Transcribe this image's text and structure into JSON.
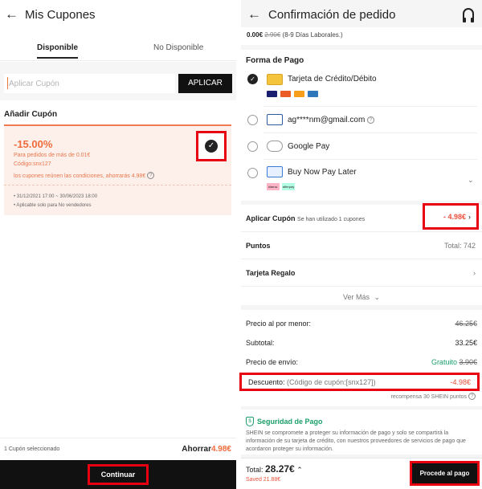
{
  "left": {
    "title": "Mis Cupones",
    "tabs": [
      "Disponible",
      "No Disponible"
    ],
    "input_placeholder": "Aplicar Cupón",
    "apply_label": "APLICAR",
    "section_label": "Añadir Cupón",
    "coupon": {
      "percent": "-15.00%",
      "min_order": "Para pedidos de más de 0.01€",
      "code": "Código:snx127",
      "savings_note": "los cupones reúnen las condiciones, ahorrarás 4.98€",
      "validity": "• 31/12/2021  17:00 ~ 30/06/2023  18:00",
      "scope": "• Aplicable solo para No vendedores",
      "check": "✓"
    },
    "footer": {
      "selected": "1 Cupón seleccionado",
      "ahorrar_label": "Ahorrar",
      "ahorrar_amount": "4.98€",
      "continue_label": "Continuar"
    }
  },
  "right": {
    "title": "Confirmación de pedido",
    "shipping": {
      "price": "0.00€",
      "old_price": "2.90€",
      "days": "(8-9 Días Laborales.)"
    },
    "payment": {
      "title": "Forma de Pago",
      "methods": [
        {
          "label": "Tarjeta de Crédito/Débito",
          "selected": true,
          "icon": "credit-card-icon"
        },
        {
          "label": "ag****nm@gmail.com",
          "selected": false,
          "icon": "paypal-icon"
        },
        {
          "label": "Google Pay",
          "selected": false,
          "icon": "google-pay-icon"
        },
        {
          "label": "Buy Now Pay Later",
          "selected": false,
          "icon": "calendar-icon"
        }
      ],
      "bnpl_logos": [
        "klarna.",
        "afterpay"
      ]
    },
    "options": {
      "coupon_label": "Aplicar Cupón",
      "coupon_sub": "Se han utilizado 1 cupones",
      "coupon_value": "- 4.98€",
      "points_label": "Puntos",
      "points_value": "Total: 742",
      "gift_label": "Tarjeta Regalo",
      "ver_mas": "Ver Más"
    },
    "summary": {
      "retail_label": "Precio al por menor:",
      "retail_value": "46.25€",
      "subtotal_label": "Subtotal:",
      "subtotal_value": "33.25€",
      "shipping_label": "Precio de envío:",
      "shipping_free": "Gratuito",
      "shipping_old": "3.90€",
      "discount_label": "Descuento:",
      "discount_code": "(Código de cupón:[snx127])",
      "discount_value": "-4.98€",
      "reward": "recompensa 30 SHEIN puntos"
    },
    "security": {
      "title": "Seguridad de Pago",
      "text": "SHEIN se compromete a proteger su información de pago y solo se compartirá la información de su tarjeta de crédito, con nuestros proveedores de servicios de pago que acordaron proteger su información."
    },
    "footer": {
      "total_label": "Total:",
      "total_value": "28.27€",
      "saved": "Saved 21.88€",
      "proceed_label": "Procede al pago"
    }
  },
  "colors": {
    "accent_orange": "#ee6b3c",
    "highlight_red": "#e60012",
    "success_green": "#1b9f6a"
  }
}
